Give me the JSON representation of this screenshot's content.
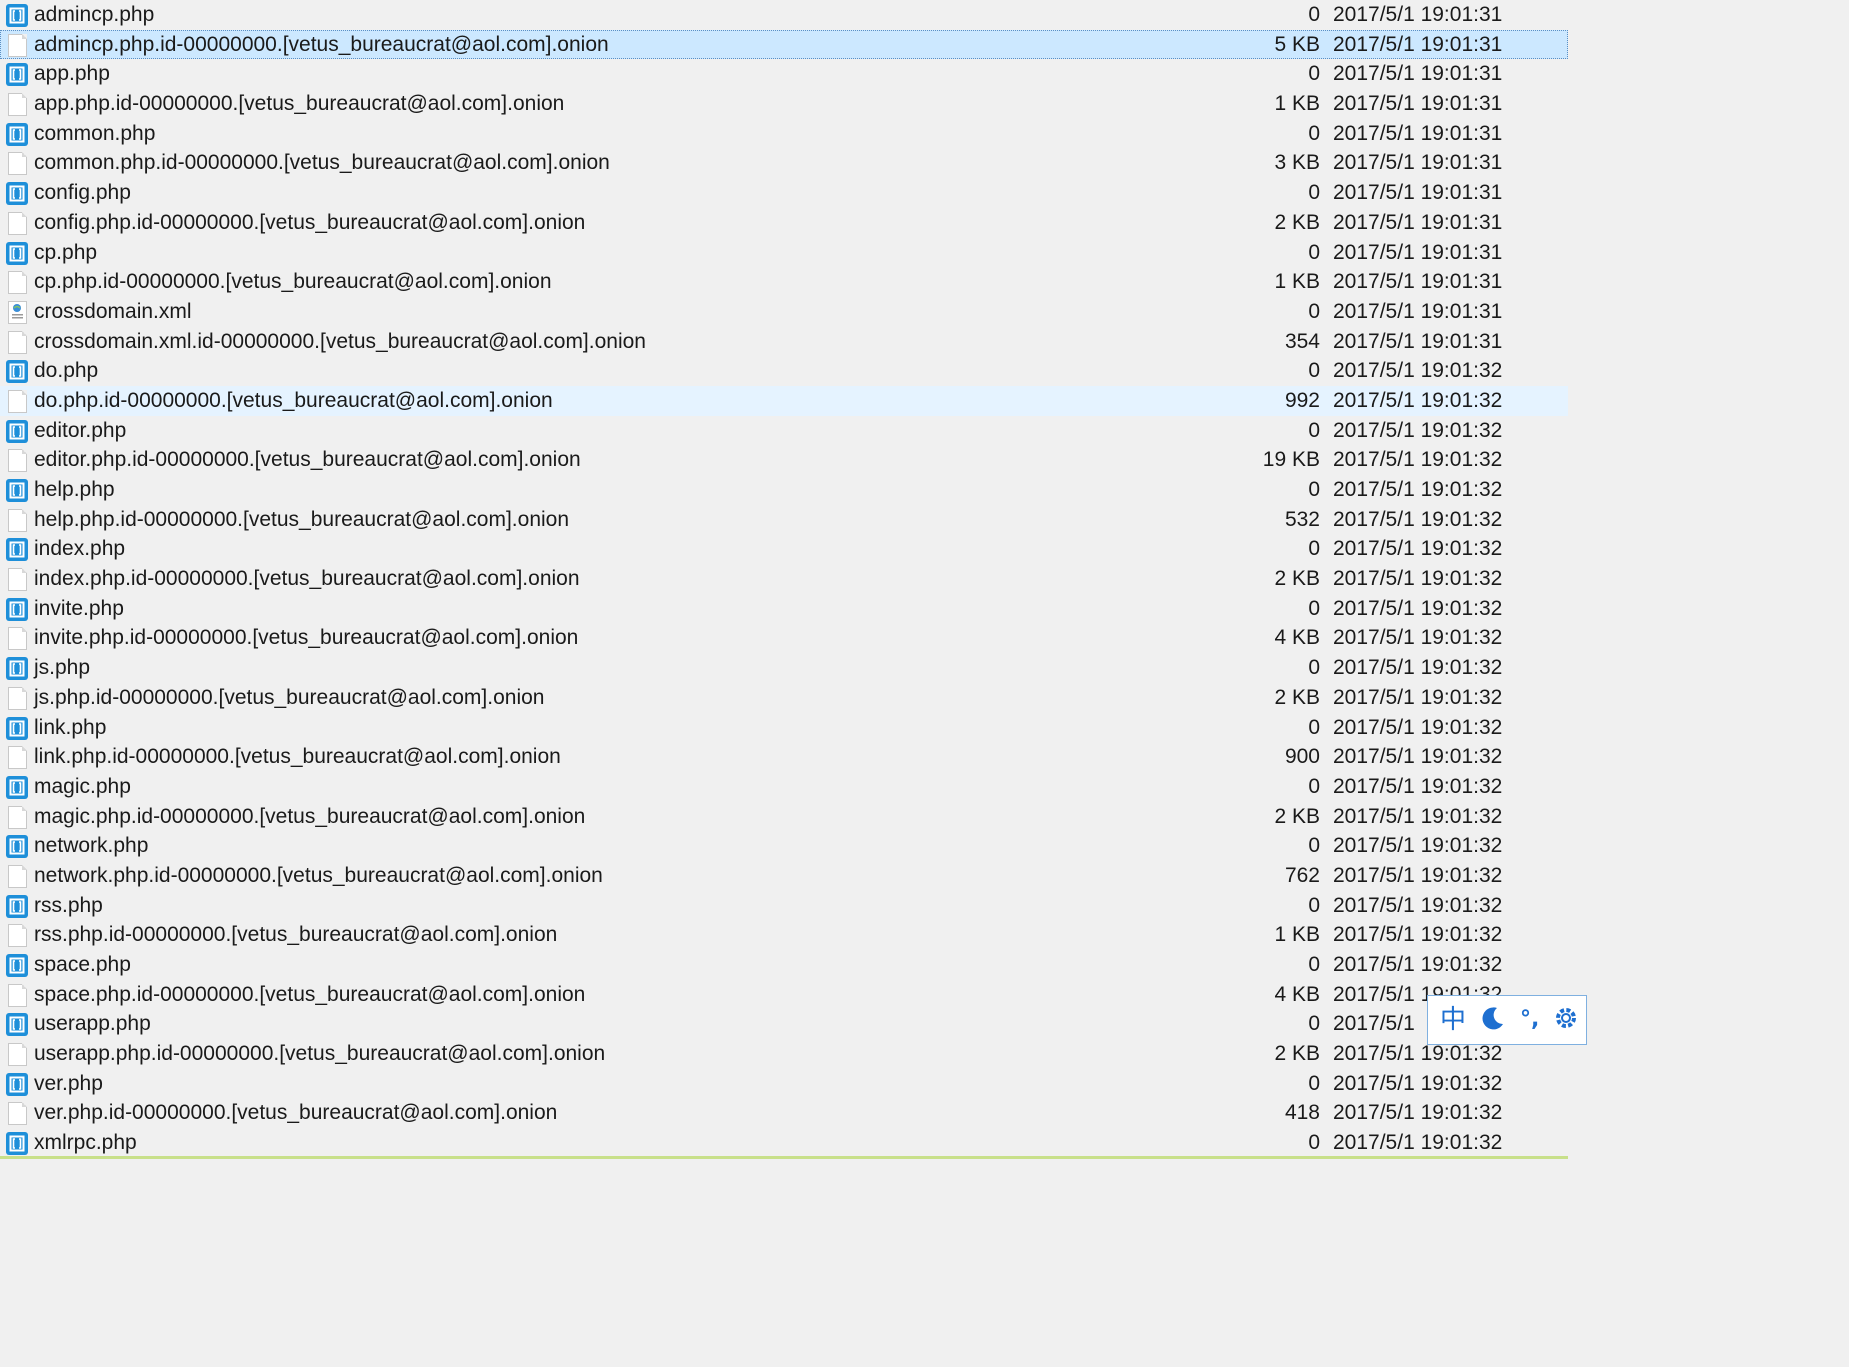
{
  "files": [
    {
      "name": "admincp.php",
      "size": "0",
      "date": "2017/5/1 19:01:31",
      "icon": "php-file-icon",
      "state": ""
    },
    {
      "name": "admincp.php.id-00000000.[vetus_bureaucrat@aol.com].onion",
      "size": "5 KB",
      "date": "2017/5/1 19:01:31",
      "icon": "blank-file-icon",
      "state": "selected"
    },
    {
      "name": "app.php",
      "size": "0",
      "date": "2017/5/1 19:01:31",
      "icon": "php-file-icon",
      "state": ""
    },
    {
      "name": "app.php.id-00000000.[vetus_bureaucrat@aol.com].onion",
      "size": "1 KB",
      "date": "2017/5/1 19:01:31",
      "icon": "blank-file-icon",
      "state": ""
    },
    {
      "name": "common.php",
      "size": "0",
      "date": "2017/5/1 19:01:31",
      "icon": "php-file-icon",
      "state": ""
    },
    {
      "name": "common.php.id-00000000.[vetus_bureaucrat@aol.com].onion",
      "size": "3 KB",
      "date": "2017/5/1 19:01:31",
      "icon": "blank-file-icon",
      "state": ""
    },
    {
      "name": "config.php",
      "size": "0",
      "date": "2017/5/1 19:01:31",
      "icon": "php-file-icon",
      "state": ""
    },
    {
      "name": "config.php.id-00000000.[vetus_bureaucrat@aol.com].onion",
      "size": "2 KB",
      "date": "2017/5/1 19:01:31",
      "icon": "blank-file-icon",
      "state": ""
    },
    {
      "name": "cp.php",
      "size": "0",
      "date": "2017/5/1 19:01:31",
      "icon": "php-file-icon",
      "state": ""
    },
    {
      "name": "cp.php.id-00000000.[vetus_bureaucrat@aol.com].onion",
      "size": "1 KB",
      "date": "2017/5/1 19:01:31",
      "icon": "blank-file-icon",
      "state": ""
    },
    {
      "name": "crossdomain.xml",
      "size": "0",
      "date": "2017/5/1 19:01:31",
      "icon": "xml-file-icon",
      "state": ""
    },
    {
      "name": "crossdomain.xml.id-00000000.[vetus_bureaucrat@aol.com].onion",
      "size": "354",
      "date": "2017/5/1 19:01:31",
      "icon": "blank-file-icon",
      "state": ""
    },
    {
      "name": "do.php",
      "size": "0",
      "date": "2017/5/1 19:01:32",
      "icon": "php-file-icon",
      "state": ""
    },
    {
      "name": "do.php.id-00000000.[vetus_bureaucrat@aol.com].onion",
      "size": "992",
      "date": "2017/5/1 19:01:32",
      "icon": "blank-file-icon",
      "state": "hover"
    },
    {
      "name": "editor.php",
      "size": "0",
      "date": "2017/5/1 19:01:32",
      "icon": "php-file-icon",
      "state": ""
    },
    {
      "name": "editor.php.id-00000000.[vetus_bureaucrat@aol.com].onion",
      "size": "19 KB",
      "date": "2017/5/1 19:01:32",
      "icon": "blank-file-icon",
      "state": ""
    },
    {
      "name": "help.php",
      "size": "0",
      "date": "2017/5/1 19:01:32",
      "icon": "php-file-icon",
      "state": ""
    },
    {
      "name": "help.php.id-00000000.[vetus_bureaucrat@aol.com].onion",
      "size": "532",
      "date": "2017/5/1 19:01:32",
      "icon": "blank-file-icon",
      "state": ""
    },
    {
      "name": "index.php",
      "size": "0",
      "date": "2017/5/1 19:01:32",
      "icon": "php-file-icon",
      "state": ""
    },
    {
      "name": "index.php.id-00000000.[vetus_bureaucrat@aol.com].onion",
      "size": "2 KB",
      "date": "2017/5/1 19:01:32",
      "icon": "blank-file-icon",
      "state": ""
    },
    {
      "name": "invite.php",
      "size": "0",
      "date": "2017/5/1 19:01:32",
      "icon": "php-file-icon",
      "state": ""
    },
    {
      "name": "invite.php.id-00000000.[vetus_bureaucrat@aol.com].onion",
      "size": "4 KB",
      "date": "2017/5/1 19:01:32",
      "icon": "blank-file-icon",
      "state": ""
    },
    {
      "name": "js.php",
      "size": "0",
      "date": "2017/5/1 19:01:32",
      "icon": "php-file-icon",
      "state": ""
    },
    {
      "name": "js.php.id-00000000.[vetus_bureaucrat@aol.com].onion",
      "size": "2 KB",
      "date": "2017/5/1 19:01:32",
      "icon": "blank-file-icon",
      "state": ""
    },
    {
      "name": "link.php",
      "size": "0",
      "date": "2017/5/1 19:01:32",
      "icon": "php-file-icon",
      "state": ""
    },
    {
      "name": "link.php.id-00000000.[vetus_bureaucrat@aol.com].onion",
      "size": "900",
      "date": "2017/5/1 19:01:32",
      "icon": "blank-file-icon",
      "state": ""
    },
    {
      "name": "magic.php",
      "size": "0",
      "date": "2017/5/1 19:01:32",
      "icon": "php-file-icon",
      "state": ""
    },
    {
      "name": "magic.php.id-00000000.[vetus_bureaucrat@aol.com].onion",
      "size": "2 KB",
      "date": "2017/5/1 19:01:32",
      "icon": "blank-file-icon",
      "state": ""
    },
    {
      "name": "network.php",
      "size": "0",
      "date": "2017/5/1 19:01:32",
      "icon": "php-file-icon",
      "state": ""
    },
    {
      "name": "network.php.id-00000000.[vetus_bureaucrat@aol.com].onion",
      "size": "762",
      "date": "2017/5/1 19:01:32",
      "icon": "blank-file-icon",
      "state": ""
    },
    {
      "name": "rss.php",
      "size": "0",
      "date": "2017/5/1 19:01:32",
      "icon": "php-file-icon",
      "state": ""
    },
    {
      "name": "rss.php.id-00000000.[vetus_bureaucrat@aol.com].onion",
      "size": "1 KB",
      "date": "2017/5/1 19:01:32",
      "icon": "blank-file-icon",
      "state": ""
    },
    {
      "name": "space.php",
      "size": "0",
      "date": "2017/5/1 19:01:32",
      "icon": "php-file-icon",
      "state": ""
    },
    {
      "name": "space.php.id-00000000.[vetus_bureaucrat@aol.com].onion",
      "size": "4 KB",
      "date": "2017/5/1 19:01:32",
      "icon": "blank-file-icon",
      "state": ""
    },
    {
      "name": "userapp.php",
      "size": "0",
      "date": "2017/5/1",
      "icon": "php-file-icon",
      "state": ""
    },
    {
      "name": "userapp.php.id-00000000.[vetus_bureaucrat@aol.com].onion",
      "size": "2 KB",
      "date": "2017/5/1 19:01:32",
      "icon": "blank-file-icon",
      "state": ""
    },
    {
      "name": "ver.php",
      "size": "0",
      "date": "2017/5/1 19:01:32",
      "icon": "php-file-icon",
      "state": ""
    },
    {
      "name": "ver.php.id-00000000.[vetus_bureaucrat@aol.com].onion",
      "size": "418",
      "date": "2017/5/1 19:01:32",
      "icon": "blank-file-icon",
      "state": ""
    },
    {
      "name": "xmlrpc.php",
      "size": "0",
      "date": "2017/5/1 19:01:32",
      "icon": "php-file-icon",
      "state": ""
    }
  ],
  "ime_toolbar": {
    "mode_label": "中",
    "moon_icon": "moon-icon",
    "punct_label": "°,",
    "settings_icon": "gear-icon"
  },
  "colors": {
    "background": "#f0f0f0",
    "selected_row": "#cce8ff",
    "hover_row": "#e5f3ff",
    "php_icon": "#1e8fd9",
    "ime_accent": "#1e6fd0"
  }
}
